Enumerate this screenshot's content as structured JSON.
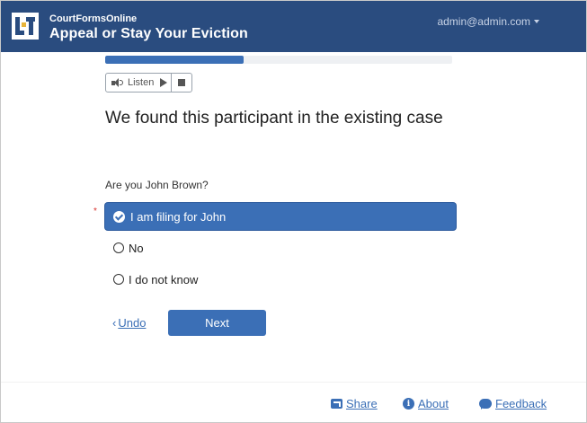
{
  "header": {
    "org_name": "CourtFormsOnline",
    "app_title": "Appeal or Stay Your Eviction",
    "user": "admin@admin.com"
  },
  "progress": {
    "fraction": 0.4
  },
  "listen": {
    "label": "Listen"
  },
  "question": {
    "title": "We found this participant in the existing case",
    "label": "Are you John Brown?",
    "required_mark": "*",
    "options": [
      {
        "label": "I am filing for John",
        "selected": true
      },
      {
        "label": "No",
        "selected": false
      },
      {
        "label": "I do not know",
        "selected": false
      }
    ]
  },
  "actions": {
    "undo": "Undo",
    "next": "Next"
  },
  "footer": {
    "share": "Share",
    "about": "About",
    "feedback": "Feedback"
  },
  "colors": {
    "header": "#2a4c7f",
    "accent": "#3b6fb6"
  }
}
